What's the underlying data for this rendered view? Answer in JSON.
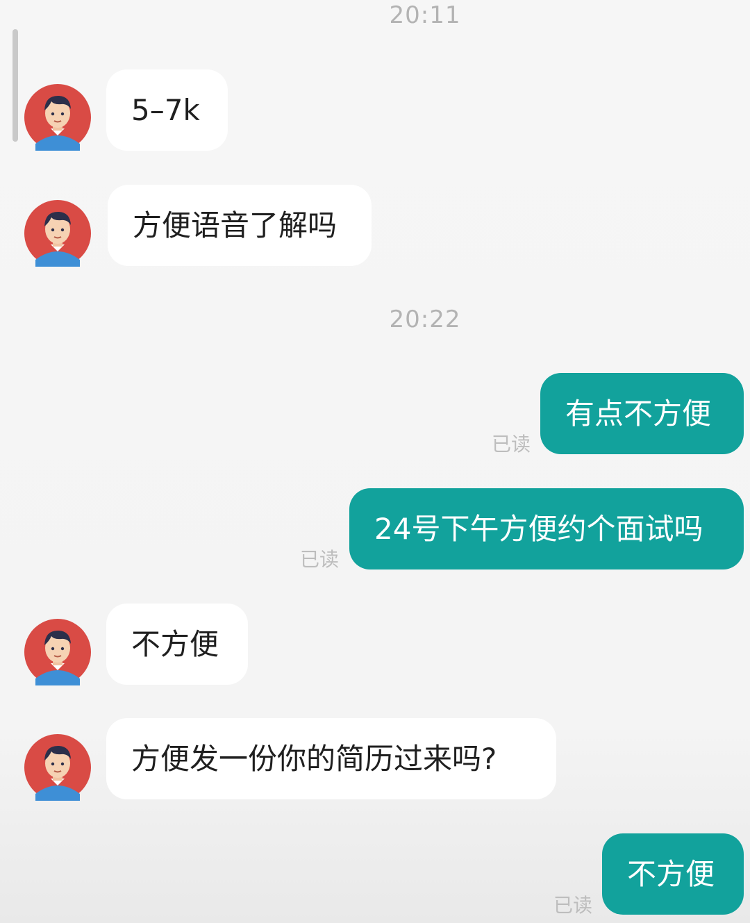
{
  "timestamps": [
    "20:11",
    "20:22"
  ],
  "messages": [
    {
      "from": "them",
      "text": "5–7k"
    },
    {
      "from": "them",
      "text": "方便语音了解吗"
    },
    {
      "from": "me",
      "text": "有点不方便",
      "status": "已读"
    },
    {
      "from": "me",
      "text": "24号下午方便约个面试吗",
      "status": "已读"
    },
    {
      "from": "them",
      "text": "不方便"
    },
    {
      "from": "them",
      "text": "方便发一份你的简历过来吗?"
    },
    {
      "from": "me",
      "text": "不方便",
      "status": "已读"
    }
  ],
  "colors": {
    "background": "#f5f5f5",
    "incoming_bubble": "#ffffff",
    "outgoing_bubble": "#12a29c",
    "avatar_bg": "#d94b45"
  },
  "icons": {
    "avatar": "recruiter-avatar-icon"
  }
}
